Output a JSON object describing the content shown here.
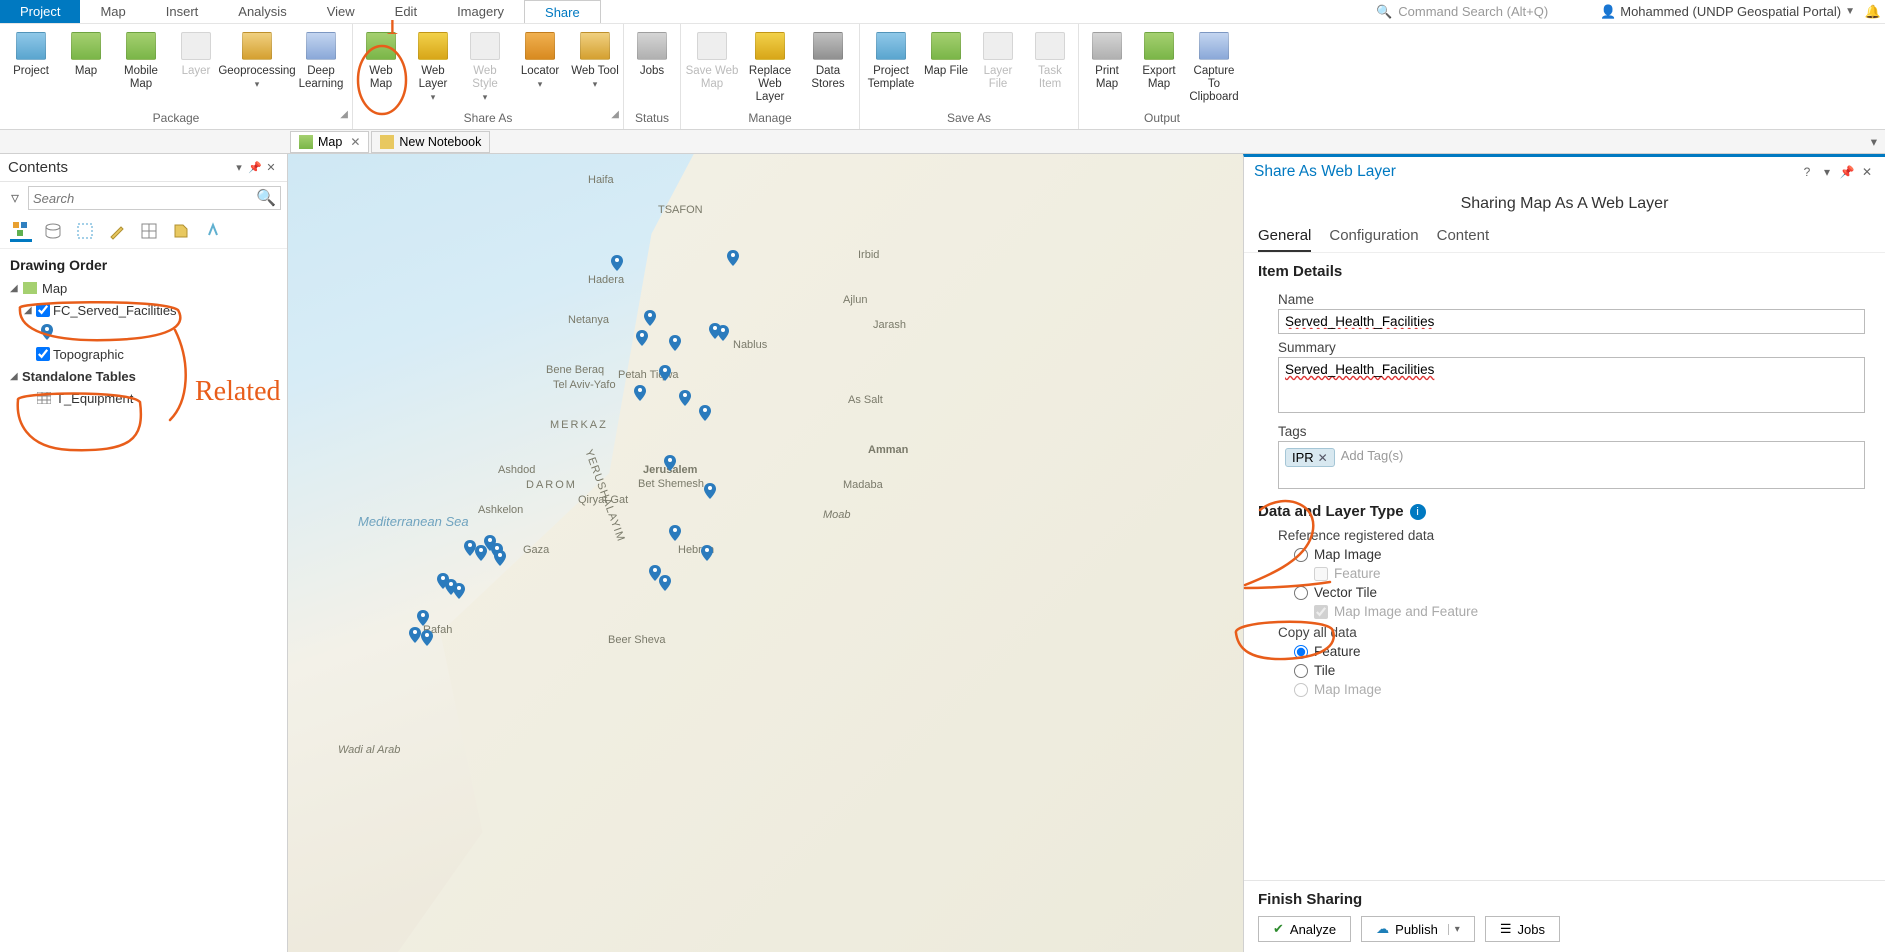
{
  "menu": {
    "tabs": [
      "Project",
      "Map",
      "Insert",
      "Analysis",
      "View",
      "Edit",
      "Imagery",
      "Share"
    ],
    "command_search_placeholder": "Command Search (Alt+Q)",
    "user": "Mohammed (UNDP Geospatial Portal)"
  },
  "ribbon": {
    "groups": {
      "package": {
        "label": "Package",
        "items": [
          "Project",
          "Map",
          "Mobile Map",
          "Layer",
          "Geoprocessing",
          "Deep Learning"
        ]
      },
      "share_as": {
        "label": "Share As",
        "items": [
          "Web Map",
          "Web Layer",
          "Web Style",
          "Locator",
          "Web Tool"
        ]
      },
      "status": {
        "label": "Status",
        "items": [
          "Jobs"
        ]
      },
      "manage": {
        "label": "Manage",
        "items": [
          "Save Web Map",
          "Replace Web Layer",
          "Data Stores"
        ]
      },
      "save_as": {
        "label": "Save As",
        "items": [
          "Project Template",
          "Map File",
          "Layer File",
          "Task Item"
        ]
      },
      "output": {
        "label": "Output",
        "items": [
          "Print Map",
          "Export Map",
          "Capture To Clipboard"
        ]
      }
    }
  },
  "dock": {
    "map_tab": "Map",
    "notebook_tab": "New Notebook"
  },
  "contents": {
    "title": "Contents",
    "search_placeholder": "Search",
    "drawing_order": "Drawing Order",
    "map": "Map",
    "fc": "FC_Served_Facilities",
    "topo": "Topographic",
    "standalone": "Standalone Tables",
    "equip": "T_Equipment"
  },
  "map": {
    "sea": "Mediterranean Sea",
    "cities": {
      "haifa": "Haifa",
      "tsafon": "TSAFON",
      "hadera": "Hadera",
      "netanya": "Netanya",
      "nablus": "Nablus",
      "telaviv": "Tel Aviv-Yafo",
      "beneberaq": "Bene Beraq",
      "petah": "Petah Tiqwa",
      "jerusalem": "Jerusalem",
      "betshemesh": "Bet Shemesh",
      "ashdod": "Ashdod",
      "ashkelon": "Ashkelon",
      "gaza": "Gaza",
      "hebron": "Hebron",
      "beersheva": "Beer Sheva",
      "rafah": "Rafah",
      "assalt": "As Salt",
      "amman": "Amman",
      "madaba": "Madaba",
      "ajlun": "Ajlun",
      "jarash": "Jarash",
      "irbid": "Irbid",
      "qiryatgat": "Qiryat Gat",
      "merkaz": "MERKAZ",
      "darom": "DAROM",
      "yerushalayim": "YERUSHALAYIM",
      "wadi": "Wadi al Arab",
      "moab": "Moab"
    }
  },
  "share": {
    "title": "Share As Web Layer",
    "subtitle": "Sharing Map As A Web Layer",
    "tabs": [
      "General",
      "Configuration",
      "Content"
    ],
    "item_details": "Item Details",
    "name_label": "Name",
    "name_value": "Served_Health_Facilities",
    "summary_label": "Summary",
    "summary_value": "Served_Health_Facilities",
    "tags_label": "Tags",
    "tag": "IPR",
    "add_tags": "Add Tag(s)",
    "data_layer_type": "Data and Layer Type",
    "ref_registered": "Reference registered data",
    "map_image": "Map Image",
    "feature": "Feature",
    "vector_tile": "Vector Tile",
    "map_image_feature": "Map Image and Feature",
    "copy_all": "Copy all data",
    "tile": "Tile",
    "map_image2": "Map Image",
    "finish": "Finish Sharing",
    "analyze": "Analyze",
    "publish": "Publish",
    "jobs": "Jobs"
  },
  "annotations": {
    "related": "Related"
  }
}
